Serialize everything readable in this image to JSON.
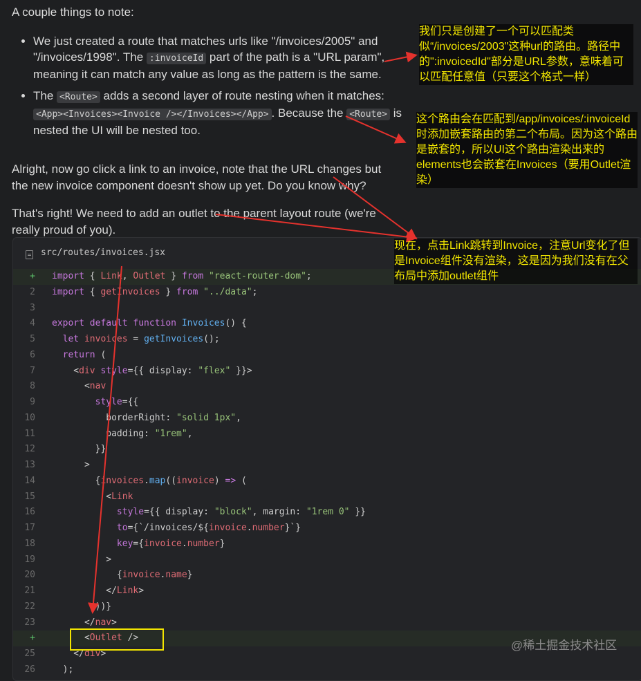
{
  "prose": {
    "intro": "A couple things to note:",
    "bullet1": {
      "a": "We just created a route that matches urls like \"/invoices/2005\" and \"/invoices/1998\". The ",
      "code": ":invoiceId",
      "b": " part of the path is a \"URL param\", meaning it can match any value as long as the pattern is the same."
    },
    "bullet2": {
      "a": "The ",
      "code1": "<Route>",
      "b": " adds a second layer of route nesting when it matches: ",
      "code2": "<App><Invoices><Invoice /></Invoices></App>",
      "c": ". Because the ",
      "code3": "<Route>",
      "d": " is nested the UI will be nested too."
    },
    "p2": "Alright, now go click a link to an invoice, note that the URL changes but the new invoice component doesn't show up yet. Do you know why?",
    "p3": "That's right! We need to add an outlet to the parent layout route (we're really proud of you)."
  },
  "code": {
    "filename": "src/routes/invoices.jsx"
  },
  "notes": {
    "n1": "我们只是创建了一个可以匹配类似“/invoices/2003\"这种url的路由。路径中的\":invoicedId\"部分是URL参数，意味着可以匹配任意值（只要这个格式一样）",
    "n2": "这个路由会在匹配到/app/invoices/:invoiceId时添加嵌套路由的第二个布局。因为这个路由是嵌套的，所以UI这个路由渲染出来的elements也会嵌套在Invoices（要用Outlet渲染）",
    "n3": "现在，点击Link跳转到Invoice，注意Url变化了但是Invoice组件没有渲染，这是因为我们没有在父布局中添加outlet组件"
  },
  "watermark": "@稀土掘金技术社区",
  "colors": {
    "annotation": "#f2e600",
    "arrow": "#e5322d",
    "added_marker": "#5cc36a"
  }
}
